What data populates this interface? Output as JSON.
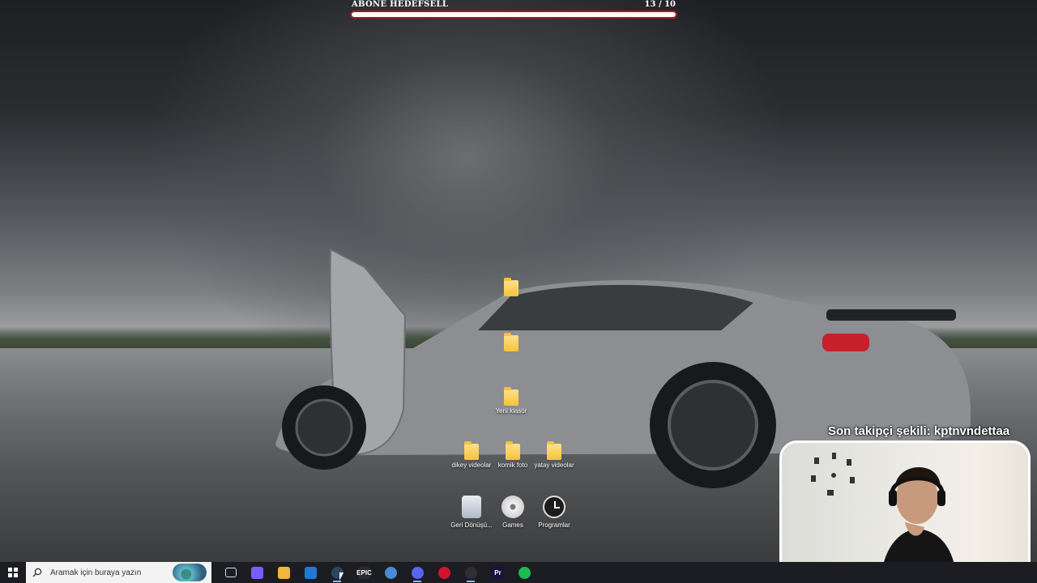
{
  "goal_widget": {
    "label": "ABONE HEDEFSELL",
    "count": "13  / 10",
    "progress_fraction": 1.0,
    "bar_color": "#b0121f"
  },
  "desktop_icons": [
    {
      "label": "",
      "kind": "folder"
    },
    {
      "label": "",
      "kind": "folder"
    },
    {
      "label": "Yeni klasör",
      "kind": "folder"
    },
    {
      "label": "dikey videolar",
      "kind": "folder"
    },
    {
      "label": "komik foto",
      "kind": "folder"
    },
    {
      "label": "yatay videolar",
      "kind": "folder"
    },
    {
      "label": "Geri Dönüşü...",
      "kind": "recycle-bin-icon"
    },
    {
      "label": "Games",
      "kind": "disc-icon"
    },
    {
      "label": "Programlar",
      "kind": "clock-icon"
    }
  ],
  "overlay": {
    "follower_text": "Son takipçi şekili: kptnvndettaa"
  },
  "taskbar": {
    "search_placeholder": "Aramak için buraya yazın",
    "pinned": [
      {
        "name": "task-view-icon",
        "glyph": "",
        "color": "#1b1d22"
      },
      {
        "name": "copilot-icon",
        "glyph": "",
        "color": "#7b5cff"
      },
      {
        "name": "file-explorer-icon",
        "glyph": "",
        "color": "#f2b63a"
      },
      {
        "name": "mail-icon",
        "glyph": "",
        "color": "#1f7ad6"
      },
      {
        "name": "steam-icon",
        "glyph": "",
        "color": "#2a475e"
      },
      {
        "name": "epic-games-icon",
        "glyph": "EPIC",
        "color": "#2b2b2b"
      },
      {
        "name": "app-blue-icon",
        "glyph": "",
        "color": "#4b8bd6"
      },
      {
        "name": "discord-icon",
        "glyph": "",
        "color": "#5865f2"
      },
      {
        "name": "opera-gx-icon",
        "glyph": "",
        "color": "#d4142a"
      },
      {
        "name": "obs-icon",
        "glyph": "",
        "color": "#302e31"
      },
      {
        "name": "premiere-pro-icon",
        "glyph": "Pr",
        "color": "#1c0f43"
      },
      {
        "name": "spotify-icon",
        "glyph": "",
        "color": "#1db954"
      }
    ]
  }
}
